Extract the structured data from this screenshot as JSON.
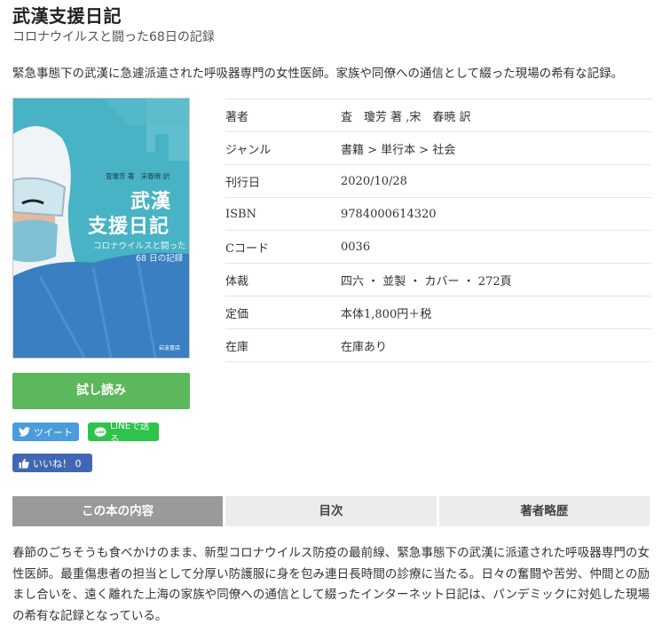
{
  "book": {
    "title": "武漢支援日記",
    "subtitle": "コロナウイルスと闘った68日の記録",
    "lead": "緊急事態下の武漢に急遽派遣された呼吸器専門の女性医師。家族や同僚への通信として綴った現場の希有な記録。"
  },
  "cover": {
    "authors": "査瓊芳 著　宋春暁 訳",
    "title_line1": "武漢",
    "title_line2": "支援日記",
    "subtitle_line1": "コロナウイルスと闘った",
    "subtitle_line2": "68 日の記録",
    "publisher": "岩波書店",
    "bg_color": "#47b3c4"
  },
  "actions": {
    "read_label": "試し読み",
    "tweet_label": "ツイート",
    "line_label": "LINEで送る",
    "like_label": "いいね！ 0"
  },
  "details": [
    {
      "label": "著者",
      "value": "査　瓊芳 著 ,宋　春暁 訳"
    },
    {
      "label": "ジャンル",
      "value": "書籍 > 単行本 > 社会"
    },
    {
      "label": "刊行日",
      "value": "2020/10/28"
    },
    {
      "label": "ISBN",
      "value": "9784000614320"
    },
    {
      "label": "Cコード",
      "value": "0036"
    },
    {
      "label": "体裁",
      "value": "四六 ・ 並製 ・ カバー ・ 272頁"
    },
    {
      "label": "定価",
      "value": "本体1,800円＋税"
    },
    {
      "label": "在庫",
      "value": "在庫あり"
    }
  ],
  "tabs": [
    {
      "label": "この本の内容",
      "active": true
    },
    {
      "label": "目次",
      "active": false
    },
    {
      "label": "著者略歴",
      "active": false
    }
  ],
  "description": "春節のごちそうも食べかけのまま、新型コロナウイルス防疫の最前線、緊急事態下の武漢に派遣された呼吸器専門の女性医師。最重傷患者の担当として分厚い防護服に身を包み連日長時間の診療に当たる。日々の奮闘や苦労、仲間との励まし合いを、遠く離れた上海の家族や同僚への通信として綴ったインターネット日記は、パンデミックに対処した現場の希有な記録となっている。",
  "colors": {
    "read_button": "#5cb85c",
    "tweet": "#4a9cdb",
    "line": "#2ec34a",
    "like": "#4267b2",
    "active_tab": "#9a9a9a"
  }
}
